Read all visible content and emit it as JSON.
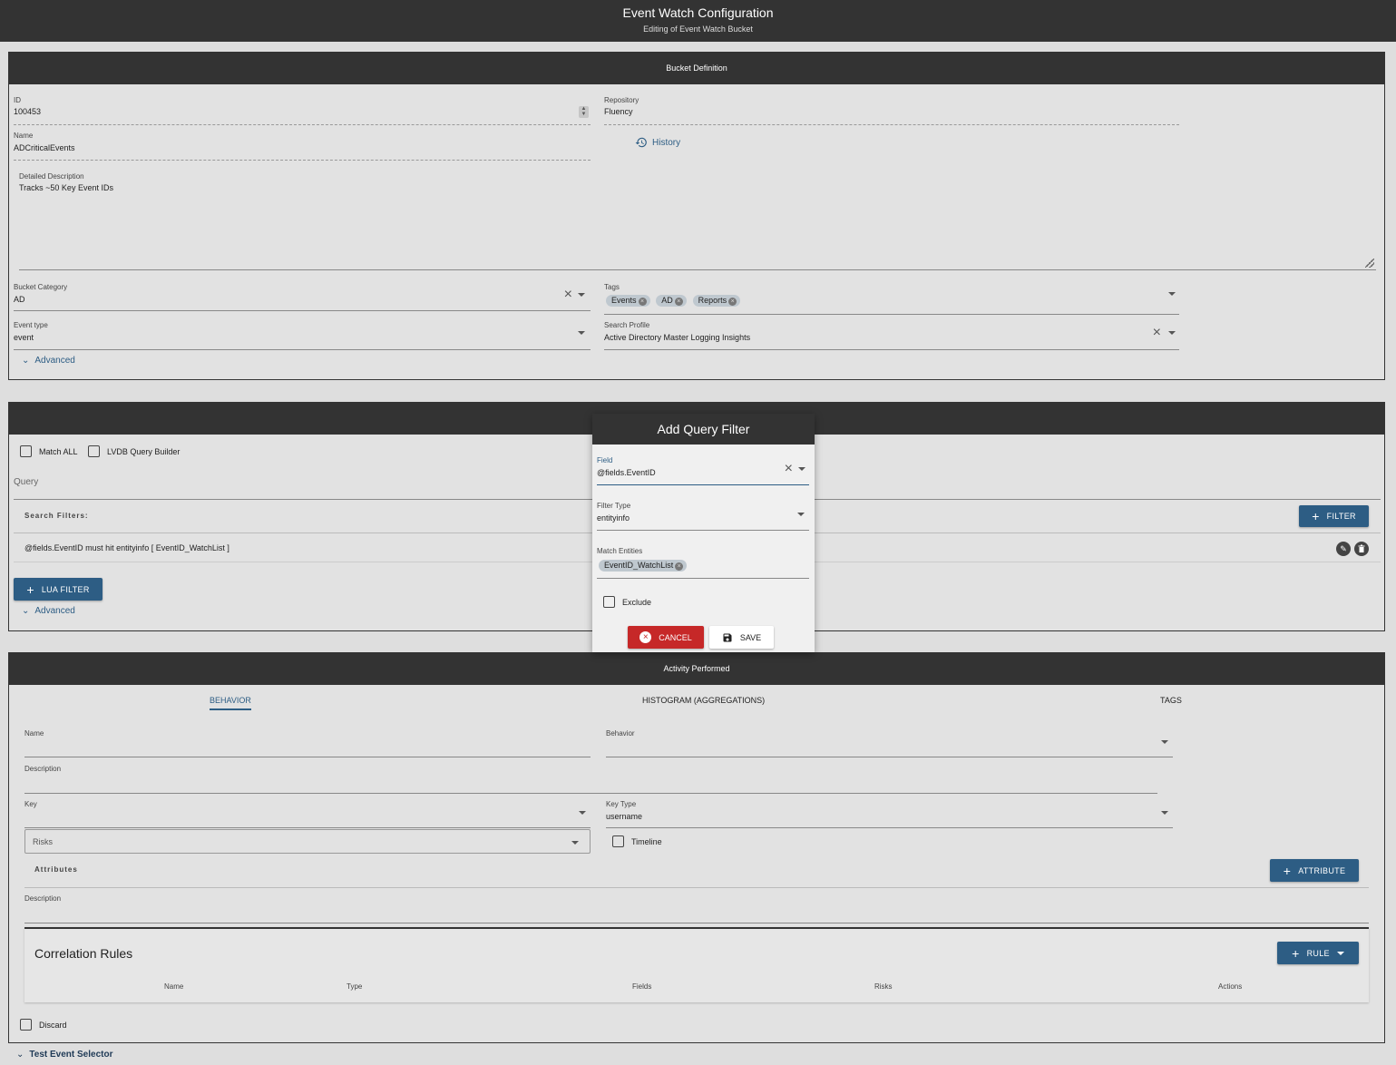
{
  "header": {
    "title": "Event Watch Configuration",
    "subtitle": "Editing of Event Watch Bucket"
  },
  "bucket": {
    "section_title": "Bucket Definition",
    "id_label": "ID",
    "id_value": "100453",
    "repository_label": "Repository",
    "repository_value": "Fluency",
    "name_label": "Name",
    "name_value": "ADCriticalEvents",
    "history_label": "History",
    "description_label": "Detailed Description",
    "description_value": "Tracks ~50 Key Event IDs",
    "category_label": "Bucket Category",
    "category_value": "AD",
    "tags_label": "Tags",
    "tags": [
      "Events",
      "AD",
      "Reports"
    ],
    "event_type_label": "Event type",
    "event_type_value": "event",
    "search_profile_label": "Search Profile",
    "search_profile_value": "Active Directory Master Logging Insights",
    "advanced_label": "Advanced"
  },
  "query": {
    "match_all_label": "Match ALL",
    "lvdb_label": "LVDB Query Builder",
    "query_label": "Query",
    "search_filters_label": "Search Filters:",
    "filter_button": "FILTER",
    "filter_row": "@fields.EventID must hit entityinfo [ EventID_WatchList ]",
    "lua_filter_button": "LUA FILTER",
    "advanced_label": "Advanced"
  },
  "dialog": {
    "title": "Add Query Filter",
    "field_label": "Field",
    "field_value": "@fields.EventID",
    "filter_type_label": "Filter Type",
    "filter_type_value": "entityinfo",
    "match_entities_label": "Match Entities",
    "match_entities": [
      "EventID_WatchList"
    ],
    "exclude_label": "Exclude",
    "cancel_label": "CANCEL",
    "save_label": "SAVE"
  },
  "activity": {
    "section_title": "Activity Performed",
    "tabs": [
      "BEHAVIOR",
      "HISTOGRAM (AGGREGATIONS)",
      "TAGS"
    ],
    "name_label": "Name",
    "behavior_label": "Behavior",
    "description_label": "Description",
    "key_label": "Key",
    "key_type_label": "Key Type",
    "key_type_value": "username",
    "risks_placeholder": "Risks",
    "timeline_label": "Timeline",
    "attributes_label": "Attributes",
    "attribute_button": "ATTRIBUTE",
    "attr_description_label": "Description",
    "correlation_title": "Correlation Rules",
    "rule_button": "RULE",
    "columns": [
      "Name",
      "Type",
      "Fields",
      "Risks",
      "Actions"
    ],
    "discard_label": "Discard"
  },
  "footer": {
    "test_event_selector": "Test Event Selector"
  },
  "colors": {
    "accent": "#2d5d84",
    "header": "#333333",
    "cancel": "#c62828"
  }
}
